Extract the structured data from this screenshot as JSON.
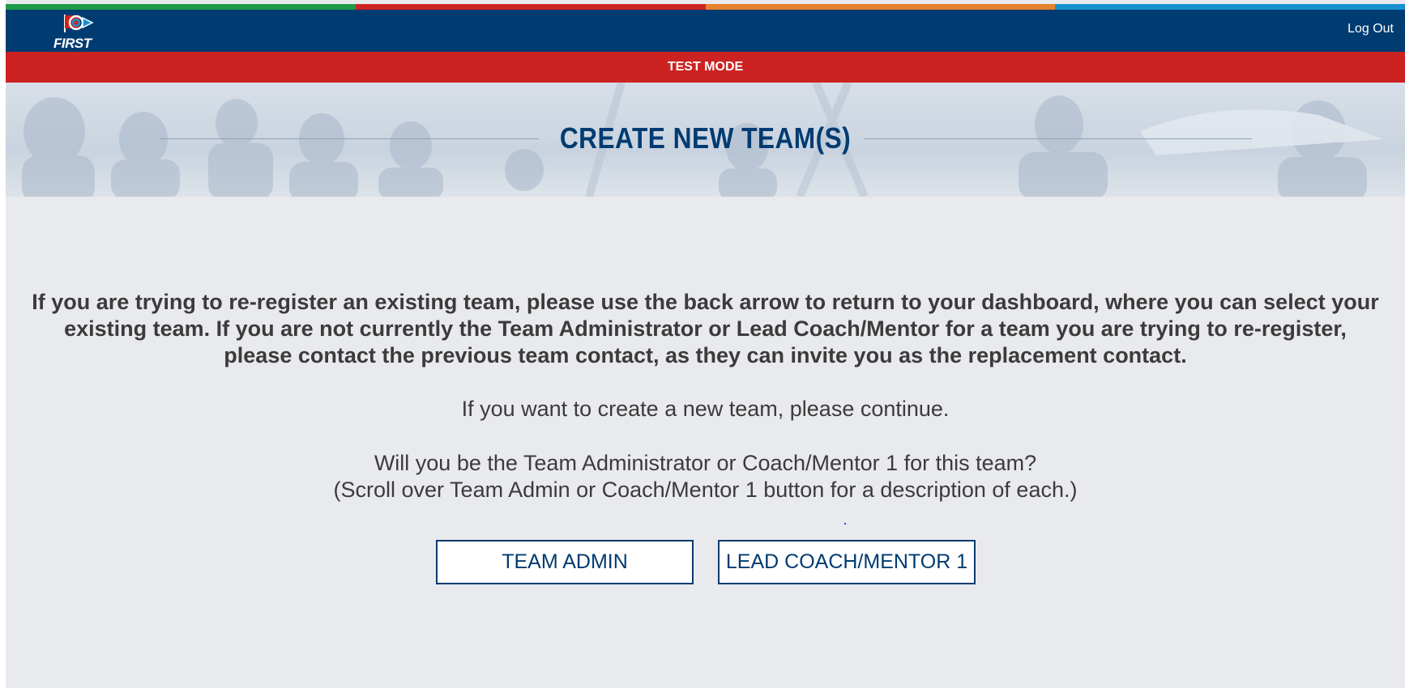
{
  "header": {
    "logo_text": "FIRST",
    "logout_label": "Log Out",
    "stripe_colors": [
      "#1f9a49",
      "#cc2322",
      "#e5822d",
      "#1891d1"
    ],
    "brand_color": "#003b71"
  },
  "test_banner": {
    "label": "TEST MODE",
    "color": "#cc2322"
  },
  "hero": {
    "title": "CREATE NEW TEAM(S)"
  },
  "main": {
    "warning_text": "If you are trying to re-register an existing team, please use the back arrow to return to your dashboard, where you can select your existing team. If you are not currently the Team Administrator or Lead Coach/Mentor for a team you are trying to re-register, please contact the previous team contact, as they can invite you as the replacement contact.",
    "continue_text": "If you want to create a new team, please continue.",
    "question_line1": "Will you be the Team Administrator or Coach/Mentor 1 for this team?",
    "question_line2": "(Scroll over Team Admin or Coach/Mentor 1 button for a description of each.)",
    "buttons": {
      "team_admin": "TEAM ADMIN",
      "lead_coach": "LEAD COACH/MENTOR 1"
    }
  }
}
